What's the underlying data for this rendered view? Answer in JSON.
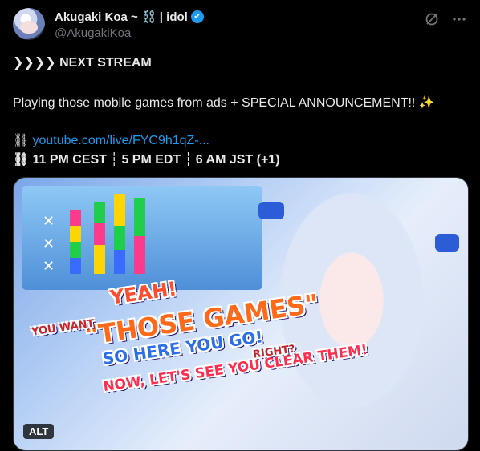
{
  "author": {
    "display_name": "Akugaki Koa ~ ⛓️ | idol",
    "handle": "@AkugakiKoa",
    "verified_icon": "✔"
  },
  "icons": {
    "grok": "grok-icon",
    "more": "more-icon",
    "arrows": "❯❯❯❯",
    "bullet": "⛓",
    "sparkles": "✨"
  },
  "tweet": {
    "heading": "NEXT STREAM",
    "body": "Playing those mobile games from ads + SPECIAL ANNOUNCEMENT!!",
    "link": "youtube.com/live/FYC9h1qZ-...",
    "times": "11 PM CEST ┆ 5 PM EDT ┆ 6 AM JST (+1)"
  },
  "media": {
    "alt_label": "ALT",
    "title_lines": [
      "YEAH!",
      "\"THOSE GAMES\"",
      "SO HERE YOU GO!",
      "NOW, LET'S SEE YOU CLEAR THEM!"
    ],
    "side_words": [
      "YOU WANT",
      "RIGHT?"
    ]
  },
  "colors": {
    "background": "#000000",
    "text": "#e7e9ea",
    "muted": "#71767b",
    "link": "#1d9bf0",
    "verified": "#1d9bf0"
  }
}
